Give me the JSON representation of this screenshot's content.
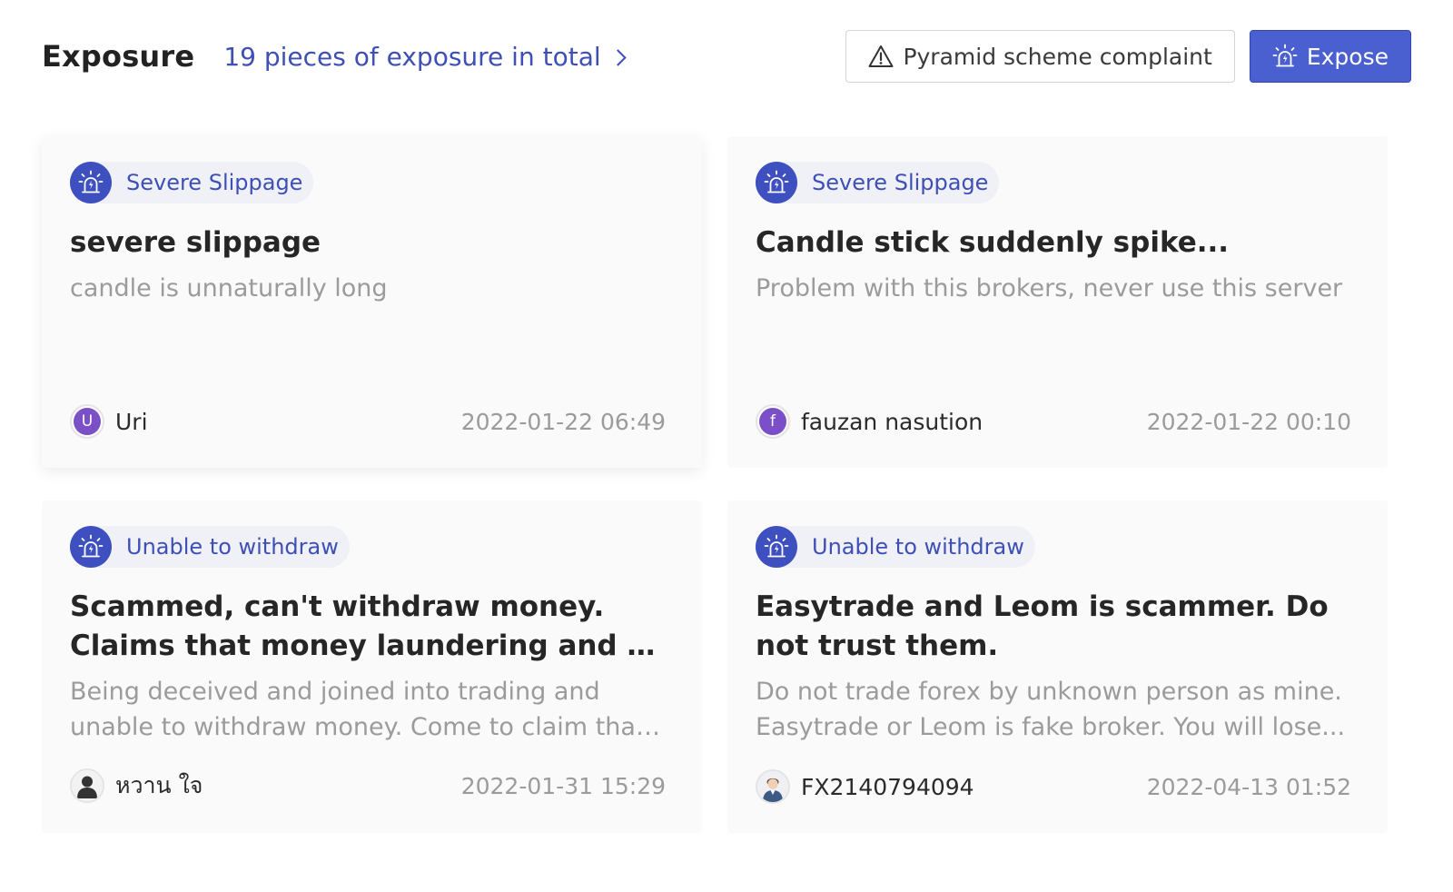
{
  "header": {
    "title": "Exposure",
    "total_link": "19 pieces of exposure in total",
    "complaint_button": "Pyramid scheme complaint",
    "expose_button": "Expose"
  },
  "colors": {
    "accent": "#3e4fb5",
    "primary_button": "#4a5fd0",
    "tag_bg": "#eff1f7",
    "avatar_purple": "#7b4fc7"
  },
  "cards": [
    {
      "tag": "Severe Slippage",
      "tag_icon": "alarm-icon",
      "title": "severe slippage",
      "description": "candle is unnaturally long",
      "user": "Uri",
      "avatar": "U",
      "date": "2022-01-22 06:49"
    },
    {
      "tag": "Severe Slippage",
      "tag_icon": "alarm-icon",
      "title": "Candle stick suddenly spike...",
      "description": "Problem with this brokers, never use this server",
      "user": "fauzan nasution",
      "avatar": "f",
      "date": "2022-01-22 00:10"
    },
    {
      "tag": "Unable to withdraw",
      "tag_icon": "alarm-icon",
      "title": "Scammed, can't withdraw money. Claims that money laundering and all acitivitie...",
      "description": "Being deceived and joined into trading and unable to withdraw money. Come to claim that ...",
      "user": "หวาน ใจ",
      "avatar": "user-silhouette-icon",
      "date": "2022-01-31 15:29"
    },
    {
      "tag": "Unable to withdraw",
      "tag_icon": "alarm-icon",
      "title": "Easytrade and Leom is scammer. Do not trust them.",
      "description": "Do not trade forex by unknown person as mine. Easytrade or Leom is fake broker. You will lose...",
      "user": "FX2140794094",
      "avatar": "user-photo-icon",
      "date": "2022-04-13 01:52"
    }
  ]
}
